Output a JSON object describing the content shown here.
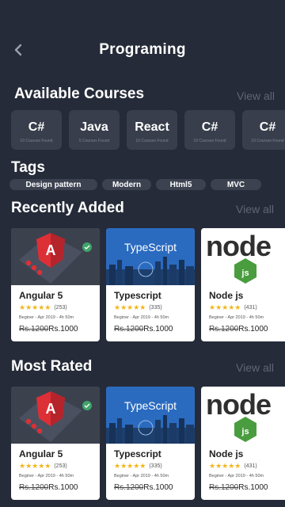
{
  "header": {
    "title": "Programing"
  },
  "available": {
    "title": "Available Courses",
    "view_all": "View all",
    "courses": [
      {
        "name": "C#",
        "count": "10 Courses Found"
      },
      {
        "name": "Java",
        "count": "5 Courses Found"
      },
      {
        "name": "React",
        "count": "10 Courses Found"
      },
      {
        "name": "C#",
        "count": "10 Courses Found"
      },
      {
        "name": "C#",
        "count": "10 Courses Found"
      }
    ]
  },
  "tags": {
    "title": "Tags",
    "items": [
      "Design pattern",
      "Modern",
      "Html5",
      "MVC"
    ]
  },
  "recent": {
    "title": "Recently Added",
    "view_all": "View all",
    "cards": [
      {
        "title": "Angular 5",
        "stars": "★★★★★",
        "rating": "(253)",
        "meta": "Beginer - Apr 2019 - 4h 50m",
        "old_price": "Rs.1200",
        "new_price": "Rs.1000",
        "thumb_label": ""
      },
      {
        "title": "Typescript",
        "stars": "★★★★★",
        "rating": "(335)",
        "meta": "Beginer - Apr 2019 - 4h 50m",
        "old_price": "Rs.1200",
        "new_price": "Rs.1000",
        "thumb_label": "TypeScript"
      },
      {
        "title": "Node js",
        "stars": "★★★★★",
        "rating": "(431)",
        "meta": "Beginer - Apr 2019 - 4h 50m",
        "old_price": "Rs.1200",
        "new_price": "Rs.1000",
        "thumb_label": "node"
      }
    ]
  },
  "rated": {
    "title": "Most Rated",
    "view_all": "View all",
    "cards": [
      {
        "title": "Angular 5",
        "stars": "★★★★★",
        "rating": "(253)",
        "meta": "Beginer - Apr 2019 - 4h 50m",
        "old_price": "Rs.1200",
        "new_price": "Rs.1000",
        "thumb_label": ""
      },
      {
        "title": "Typescript",
        "stars": "★★★★★",
        "rating": "(335)",
        "meta": "Beginer - Apr 2019 - 4h 50m",
        "old_price": "Rs.1200",
        "new_price": "Rs.1000",
        "thumb_label": "TypeScript"
      },
      {
        "title": "Node js",
        "stars": "★★★★★",
        "rating": "(431)",
        "meta": "Beginer - Apr 2019 - 4h 50m",
        "old_price": "Rs.1200",
        "new_price": "Rs.1000",
        "thumb_label": "node"
      }
    ]
  },
  "colors": {
    "background": "#252b38",
    "chip": "#383e4b",
    "tag": "#3c4250",
    "star": "#f3b61c",
    "muted": "#5f6676"
  }
}
